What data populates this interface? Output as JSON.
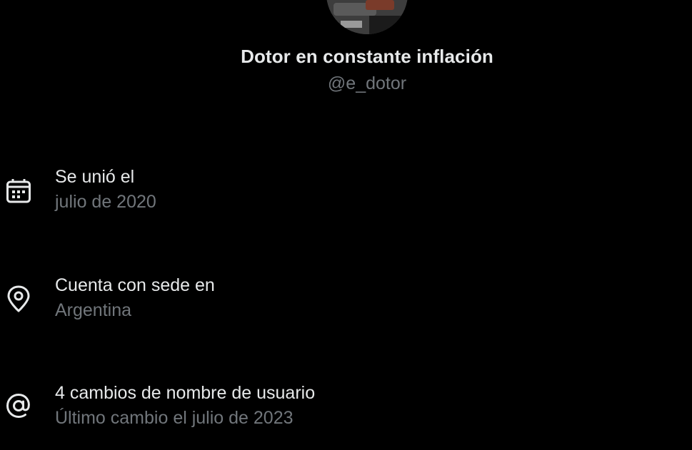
{
  "profile": {
    "display_name": "Dotor en constante inflación",
    "handle": "@e_dotor",
    "avatar_icon": "profile-avatar"
  },
  "about": {
    "items": [
      {
        "icon": "calendar-icon",
        "title": "Se unió el",
        "subtitle": "julio de 2020"
      },
      {
        "icon": "location-pin-icon",
        "title": "Cuenta con sede en",
        "subtitle": "Argentina"
      },
      {
        "icon": "at-sign-icon",
        "title": "4 cambios de nombre de usuario",
        "subtitle": "Último cambio el julio de 2023"
      }
    ]
  },
  "colors": {
    "background": "#000000",
    "primary_text": "#e7e9ea",
    "secondary_text": "#71767b"
  }
}
